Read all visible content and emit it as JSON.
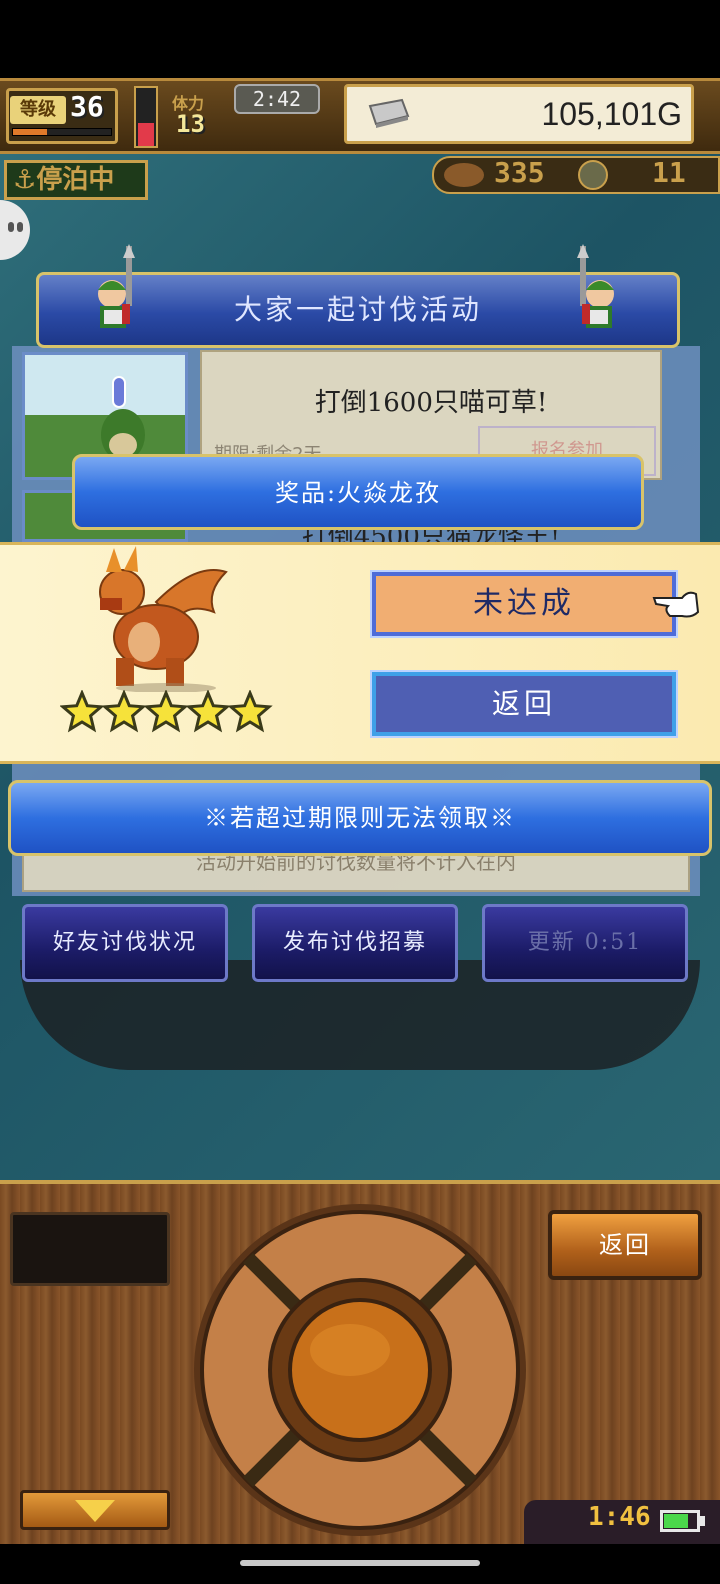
{
  "status": {
    "level_label": "等级",
    "level_value": "36",
    "exp_fraction": 0.35,
    "hp_fraction": 0.4,
    "stamina_label": "体力",
    "stamina_value": "13",
    "clock": "2:42",
    "gold": "105,101G"
  },
  "dock_status": "停泊中",
  "resources": {
    "a_value": "335",
    "b_value": "11"
  },
  "event": {
    "banner_title": "大家一起讨伐活动",
    "mission1_title": "打倒1600只喵可草!",
    "mission1_deadline": "期限:剩余2天",
    "mission1_button": "报名参加",
    "mission2_title": "打倒4500只猫龙怪王!",
    "bottom_note": "活动开始前的讨伐数量将不计入在内"
  },
  "actions": {
    "friend_status": "好友讨伐状况",
    "publish_recruit": "发布讨伐招募",
    "refresh": "更新 0:51"
  },
  "reward_popup": {
    "prize_title": "奖品:火焱龙孜",
    "star_rating": 5,
    "unachieved_button": "未达成",
    "back_button": "返回",
    "notice": "※若超过期限则无法领取※"
  },
  "controller": {
    "back_button": "返回",
    "time": "1:46",
    "battery_level": 0.7
  },
  "colors": {
    "banner_blue": "#2e6fe0",
    "gold_border": "#d8c36a",
    "unachieved_orange": "#f1ae72",
    "star_yellow": "#f6e23a"
  }
}
